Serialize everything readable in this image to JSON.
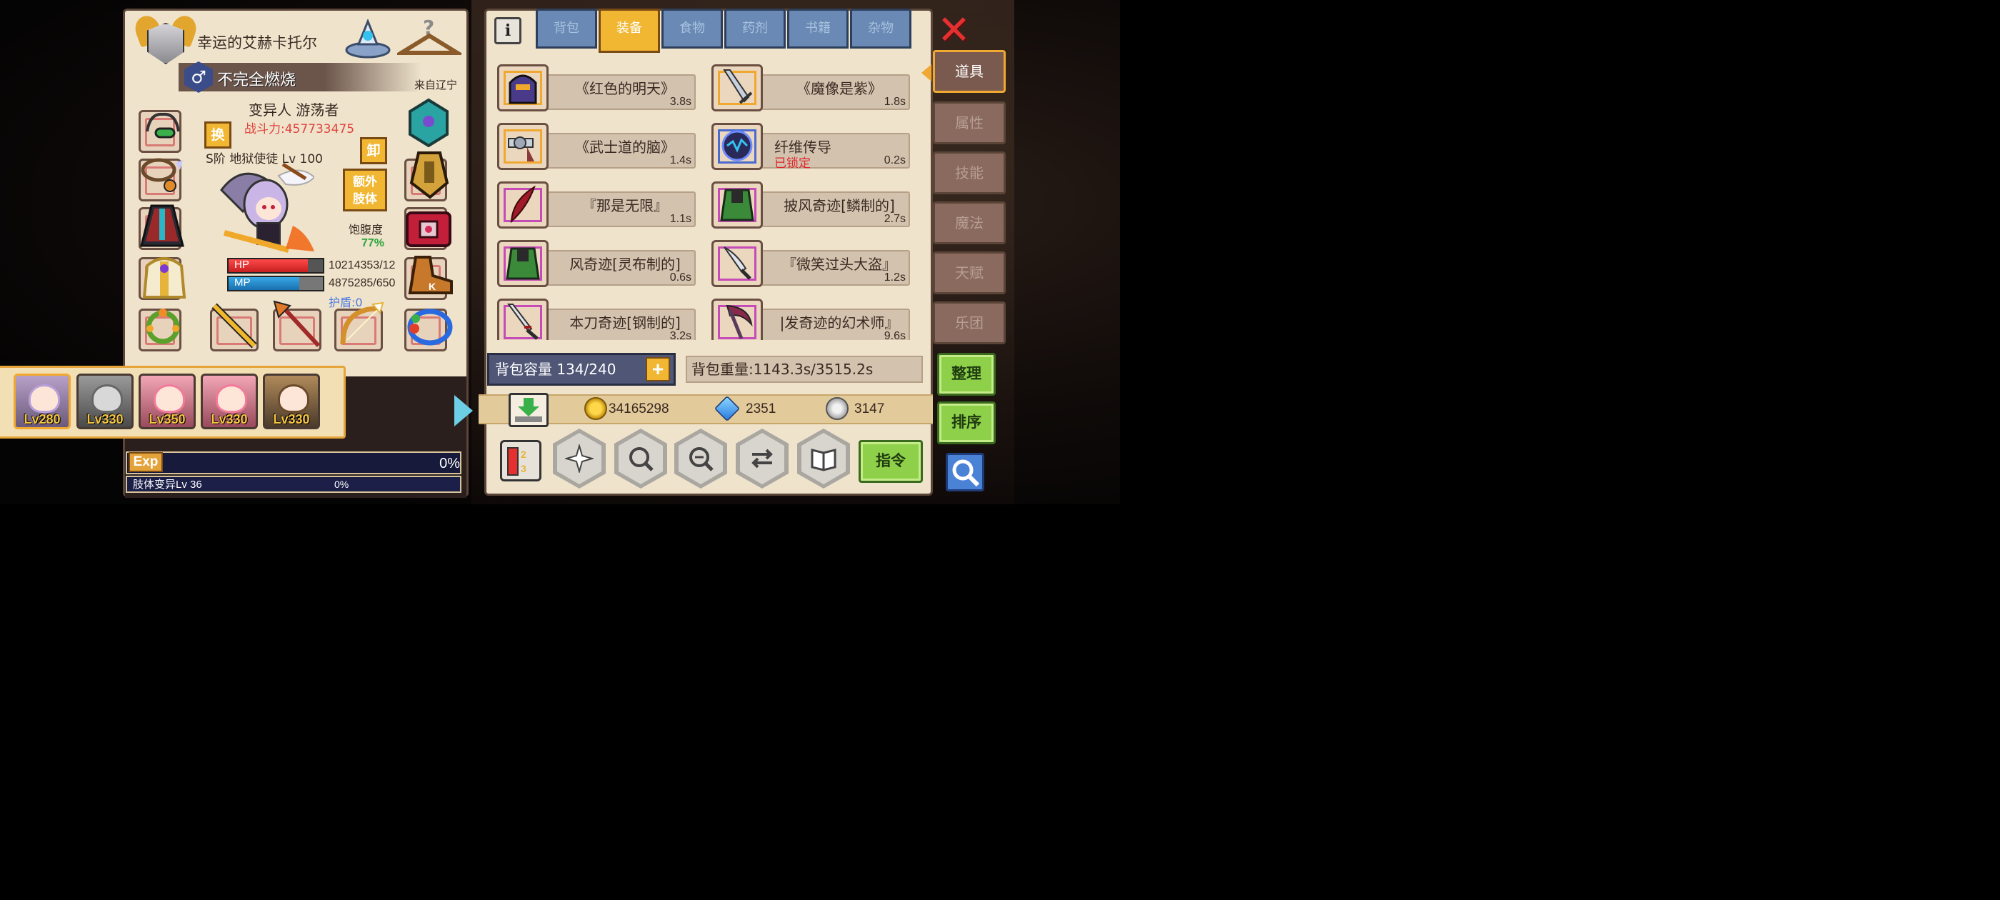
{
  "character": {
    "name": "幸运的艾赫卡托尔",
    "title": "不完全燃烧",
    "origin": "来自辽宁",
    "race_class": "变异人 游荡者",
    "power": "战斗力:457733475",
    "special_title": "S阶 地狱使徒 Lv 100",
    "swap_label": "换",
    "unequip_label": "卸",
    "extra_limb_label": "额外\n肢体",
    "hunger_label": "饱腹度",
    "hunger_value": "77%",
    "hp_label": "HP",
    "hp_value": "10214353/12",
    "hp_fraction": 0.84,
    "mp_label": "MP",
    "mp_value": "4875285/650",
    "mp_fraction": 0.75,
    "shield": "护盾:0"
  },
  "roster": [
    {
      "level": "Lv280",
      "selected": true
    },
    {
      "level": "Lv330",
      "selected": false
    },
    {
      "level": "Lv350",
      "selected": false
    },
    {
      "level": "Lv330",
      "selected": false
    },
    {
      "level": "Lv330",
      "selected": false
    }
  ],
  "exp": {
    "label": "Exp",
    "percent": "0%"
  },
  "mutation": {
    "label": "肢体变异Lv 36",
    "percent": "0%"
  },
  "tabs": [
    {
      "label": "背包",
      "active": false
    },
    {
      "label": "装备",
      "active": true
    },
    {
      "label": "食物",
      "active": false
    },
    {
      "label": "药剂",
      "active": false
    },
    {
      "label": "书籍",
      "active": false
    },
    {
      "label": "杂物",
      "active": false
    }
  ],
  "items": [
    {
      "name": "《红色的明天》",
      "time": "3.8s",
      "frame": "orange"
    },
    {
      "name": "《魔像是紫》",
      "time": "1.8s",
      "frame": "orange"
    },
    {
      "name": "《武士道的脑》",
      "time": "1.4s",
      "frame": "orange"
    },
    {
      "name": "纤维传导",
      "time": "0.2s",
      "frame": "blue",
      "locked": "已锁定"
    },
    {
      "name": "『那是无限』",
      "time": "1.1s",
      "frame": "purple"
    },
    {
      "name": "披风奇迹[鳞制的]",
      "time": "2.7s",
      "frame": "purple"
    },
    {
      "name": "风奇迹[灵布制的]",
      "time": "0.6s",
      "frame": "purple"
    },
    {
      "name": "『微笑过头大盗』",
      "time": "1.2s",
      "frame": "purple"
    },
    {
      "name": "本刀奇迹[钢制的]",
      "time": "3.2s",
      "frame": "purple"
    },
    {
      "name": "|发奇迹的幻术师』",
      "time": "9.6s",
      "frame": "purple"
    }
  ],
  "bag": {
    "capacity": "背包容量 134/240",
    "weight": "背包重量:1143.3s/3515.2s"
  },
  "currency": {
    "gold": "34165298",
    "gems": "2351",
    "silver": "3147"
  },
  "buttons": {
    "organize": "整理",
    "sort": "排序",
    "command": "指令"
  },
  "side_tabs": [
    {
      "label": "道具",
      "active": true
    },
    {
      "label": "属性",
      "active": false
    },
    {
      "label": "技能",
      "active": false
    },
    {
      "label": "魔法",
      "active": false
    },
    {
      "label": "天赋",
      "active": false
    },
    {
      "label": "乐团",
      "active": false
    }
  ],
  "colors": {
    "accent_gold": "#f2b732",
    "tab_blue": "#6a89b4",
    "locked_red": "#e0252a",
    "hunger_green": "#2aa53c",
    "power_red": "#e0453e"
  }
}
